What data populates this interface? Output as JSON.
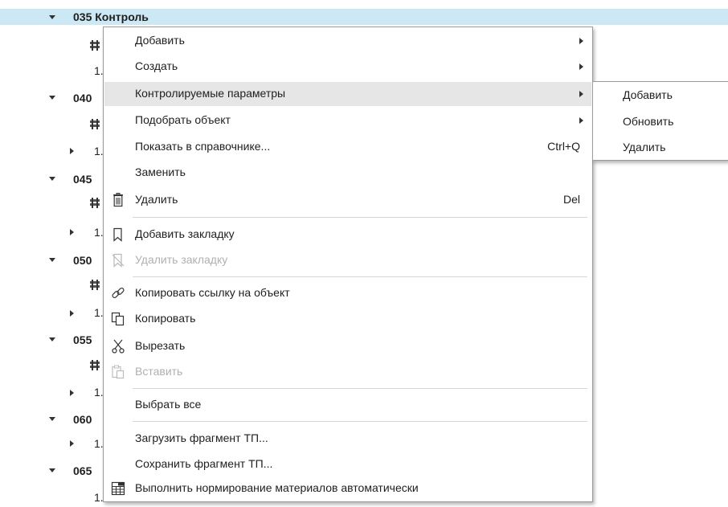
{
  "tree": {
    "selected_label": "035 Контроль",
    "rows": [
      {
        "kind": "op",
        "label": "040"
      },
      {
        "kind": "op",
        "label": "045"
      },
      {
        "kind": "op",
        "label": "050"
      },
      {
        "kind": "op",
        "label": "055"
      },
      {
        "kind": "op",
        "label": "060"
      },
      {
        "kind": "op",
        "label": "065"
      }
    ],
    "sub_number": "1."
  },
  "menu": {
    "items": [
      {
        "label": "Добавить",
        "submenu": true
      },
      {
        "label": "Создать",
        "submenu": true
      },
      {
        "label": "Контролируемые параметры",
        "submenu": true
      },
      {
        "label": "Подобрать объект",
        "submenu": true
      },
      {
        "label": "Показать в справочнике...",
        "shortcut": "Ctrl+Q"
      },
      {
        "label": "Заменить"
      },
      {
        "label": "Удалить",
        "shortcut": "Del",
        "icon": "trash-icon"
      },
      {
        "label": "Добавить закладку",
        "icon": "bookmark-icon"
      },
      {
        "label": "Удалить закладку",
        "icon": "bookmark-remove-icon",
        "disabled": true
      },
      {
        "label": "Копировать ссылку на объект",
        "icon": "link-icon"
      },
      {
        "label": "Копировать",
        "icon": "copy-icon"
      },
      {
        "label": "Вырезать",
        "icon": "scissors-icon"
      },
      {
        "label": "Вставить",
        "icon": "paste-icon",
        "disabled": true
      },
      {
        "label": "Выбрать все"
      },
      {
        "label": "Загрузить фрагмент ТП..."
      },
      {
        "label": "Сохранить фрагмент ТП..."
      },
      {
        "label": "Выполнить нормирование материалов автоматически",
        "icon": "calculator-icon"
      }
    ],
    "highlighted": "Контролируемые параметры"
  },
  "submenu": {
    "items": [
      "Добавить",
      "Обновить",
      "Удалить"
    ]
  },
  "colors": {
    "selection": "#cce8f4",
    "hover": "#e6e6e6",
    "disabled_text": "#b0b0b0"
  }
}
